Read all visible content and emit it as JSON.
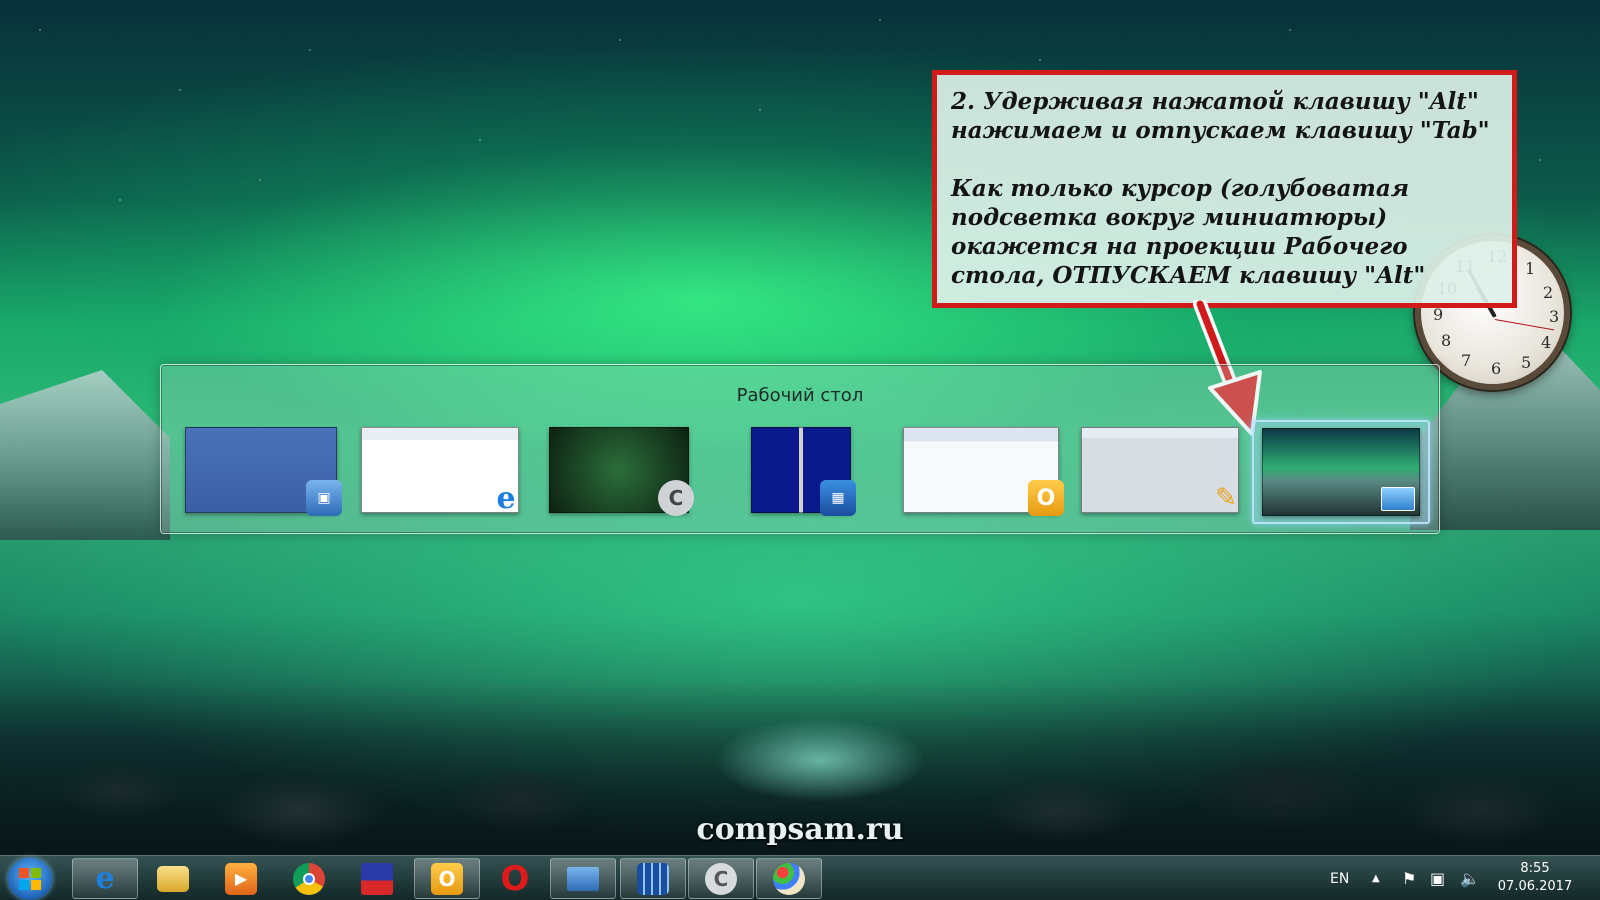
{
  "callout": {
    "line1": "2. Удерживая нажатой клавишу \"Alt\"\nнажимаем и отпускаем клавишу \"Tab\"",
    "line2": "Как только курсор (голубоватая\nподсветка вокруг миниатюры)\nокажется на проекции Рабочего\nстола, ОТПУСКАЕМ клавишу \"Alt\""
  },
  "switcher": {
    "title": "Рабочий стол",
    "thumbnails": [
      {
        "name": "remote-desktop-window",
        "icon": "remote-desktop-icon"
      },
      {
        "name": "internet-explorer-window",
        "icon": "internet-explorer-icon"
      },
      {
        "name": "ccleaner-window",
        "icon": "ccleaner-icon"
      },
      {
        "name": "total-commander-window",
        "icon": "file-manager-icon"
      },
      {
        "name": "outlook-window",
        "icon": "outlook-icon"
      },
      {
        "name": "paint-window",
        "icon": "paint-icon"
      },
      {
        "name": "desktop-preview",
        "icon": "show-desktop-icon",
        "selected": true
      }
    ]
  },
  "clock_gadget": {
    "numbers": [
      "12",
      "1",
      "2",
      "3",
      "4",
      "5",
      "6",
      "7",
      "8",
      "9",
      "10",
      "11"
    ]
  },
  "watermark": "compsam.ru",
  "taskbar": {
    "apps": [
      {
        "name": "internet-explorer",
        "icon": "internet-explorer-icon",
        "glyph": "e"
      },
      {
        "name": "windows-explorer",
        "icon": "folder-icon",
        "glyph": ""
      },
      {
        "name": "media-player",
        "icon": "media-player-icon",
        "glyph": "▶"
      },
      {
        "name": "chrome",
        "icon": "chrome-icon",
        "glyph": ""
      },
      {
        "name": "save-utility",
        "icon": "floppy-disk-icon",
        "glyph": ""
      },
      {
        "name": "outlook",
        "icon": "outlook-icon",
        "glyph": "O"
      },
      {
        "name": "opera",
        "icon": "opera-icon",
        "glyph": "O"
      },
      {
        "name": "remote-desktop",
        "icon": "remote-desktop-icon",
        "glyph": ""
      },
      {
        "name": "total-commander",
        "icon": "file-manager-icon",
        "glyph": ""
      },
      {
        "name": "ccleaner",
        "icon": "ccleaner-icon",
        "glyph": "C"
      },
      {
        "name": "paint",
        "icon": "paint-icon",
        "glyph": ""
      }
    ],
    "language": "EN",
    "time": "8:55",
    "date": "07.06.2017"
  },
  "colors": {
    "callout_border": "#d11a1a",
    "selection_glow": "#a0d2f0"
  }
}
